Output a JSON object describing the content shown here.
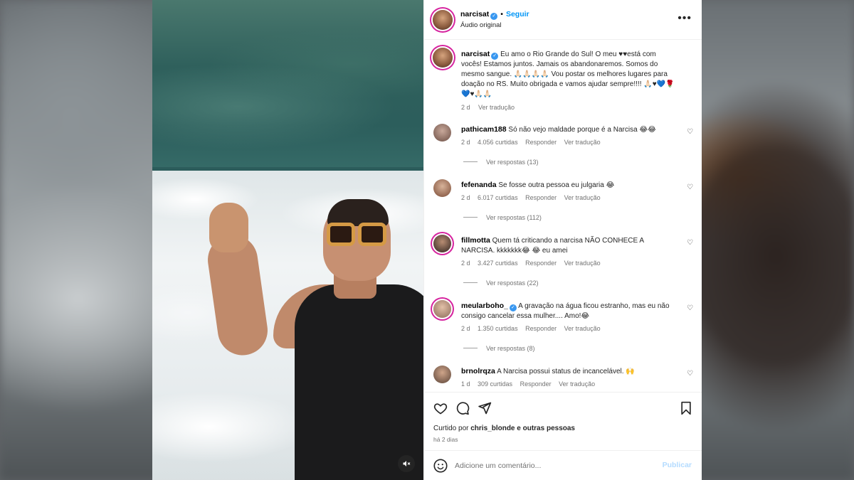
{
  "post": {
    "username": "narcisat",
    "verified": true,
    "follow_label": "Seguir",
    "audio_label": "Áudio original",
    "more_icon": "more-horizontal-icon"
  },
  "caption": {
    "username": "narcisat",
    "text": "Eu amo o Rio Grande do Sul! O meu ♥♥está com vocês! Estamos juntos. Jamais os abandonaremos. Somos do mesmo sangue. 🙏🏻🙏🏻🙏🏻🙏🏻 Vou postar os melhores lugares para doação no RS. Muito obrigada e vamos ajudar sempre!!!! 🙏🏻♥💙🌹💙♥🙏🏻🙏🏻",
    "time": "2 d",
    "translate_label": "Ver tradução"
  },
  "comments": [
    {
      "username": "pathicam188",
      "verified": false,
      "text": "Só não vejo maldade porque é a Narcisa 😂😂",
      "time": "2 d",
      "likes": "4.056 curtidas",
      "reply_label": "Responder",
      "translate_label": "Ver tradução",
      "replies_label": "Ver respostas (13)"
    },
    {
      "username": "fefenanda",
      "verified": false,
      "text": "Se fosse outra pessoa eu julgaria 😂",
      "time": "2 d",
      "likes": "6.017 curtidas",
      "reply_label": "Responder",
      "translate_label": "Ver tradução",
      "replies_label": "Ver respostas (112)"
    },
    {
      "username": "fillmotta",
      "verified": false,
      "text": "Quem tá criticando a narcisa NÃO CONHECE A NARCISA. kkkkkkk😂 😂 eu amei",
      "time": "2 d",
      "likes": "3.427 curtidas",
      "reply_label": "Responder",
      "translate_label": "Ver tradução",
      "replies_label": "Ver respostas (22)"
    },
    {
      "username": "meularboho_",
      "verified": true,
      "text": "A gravação na água ficou estranho, mas eu não consigo cancelar essa mulher.... Amo!😂",
      "time": "2 d",
      "likes": "1.350 curtidas",
      "reply_label": "Responder",
      "translate_label": "Ver tradução",
      "replies_label": "Ver respostas (8)"
    },
    {
      "username": "brnolrqza",
      "verified": false,
      "text": "A Narcisa possui status de incancelável. 🙌",
      "time": "1 d",
      "likes": "309 curtidas",
      "reply_label": "Responder",
      "translate_label": "Ver tradução",
      "replies_label": ""
    }
  ],
  "actions": {
    "liked_prefix": "Curtido por",
    "liked_user": "chris_blonde",
    "liked_suffix": "e outras pessoas",
    "time_ago": "há 2 dias"
  },
  "add_comment": {
    "placeholder": "Adicione um comentário...",
    "publish_label": "Publicar"
  },
  "colors": {
    "accent": "#0095f6",
    "verified": "#3897f0",
    "publish_disabled": "#b3dbff",
    "story_ring": "#d6249f"
  }
}
